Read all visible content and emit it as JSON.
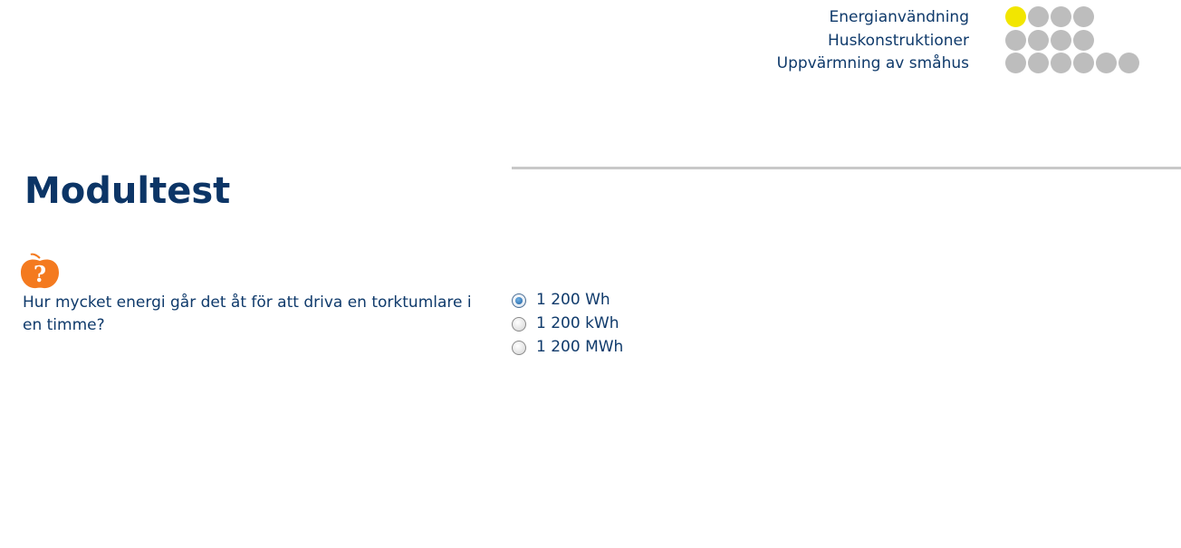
{
  "progress": [
    {
      "label": "Energianvändning",
      "total": 4,
      "completed": 1
    },
    {
      "label": "Huskonstruktioner",
      "total": 4,
      "completed": 0
    },
    {
      "label": "Uppvärmning av småhus",
      "total": 6,
      "completed": 0
    }
  ],
  "page_title": "Modultest",
  "question": {
    "icon": "question-apple-icon",
    "text": "Hur mycket energi går det åt för att driva en torktumlare i en timme?"
  },
  "options": [
    {
      "label": "1 200 Wh",
      "selected": true
    },
    {
      "label": "1 200 kWh",
      "selected": false
    },
    {
      "label": "1 200 MWh",
      "selected": false
    }
  ],
  "colors": {
    "text": "#0f3a6b",
    "title": "#0c3566",
    "dot_done": "#f2e600",
    "dot_todo": "#bdbdbd",
    "icon_orange": "#f47a1f",
    "divider": "#c8c8c8"
  }
}
